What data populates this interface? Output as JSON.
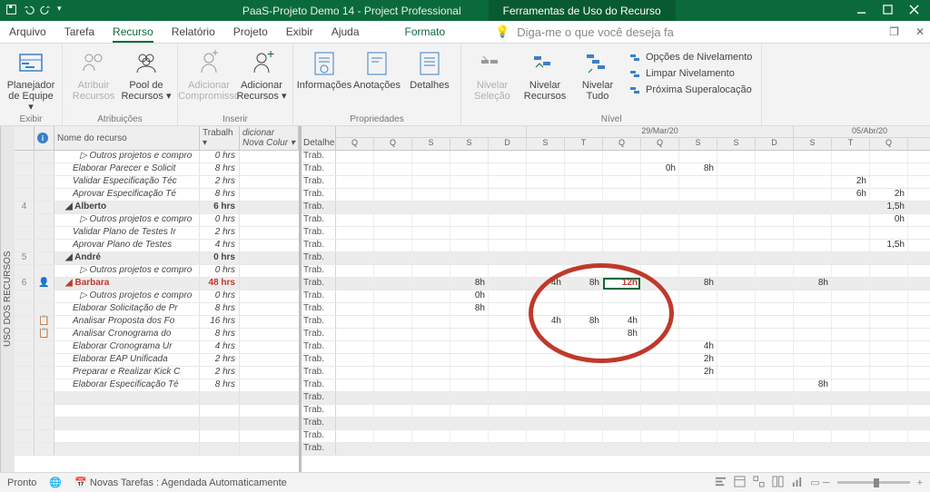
{
  "titlebar": {
    "project_title": "PaaS-Projeto Demo 14  -  Project Professional",
    "context_tab": "Ferramentas de Uso do Recurso"
  },
  "menubar": {
    "tabs": [
      "Arquivo",
      "Tarefa",
      "Recurso",
      "Relatório",
      "Projeto",
      "Exibir",
      "Ajuda",
      "Formato"
    ],
    "tellme_placeholder": "Diga-me o que você deseja fa"
  },
  "ribbon": {
    "groups": [
      {
        "label": "Exibir",
        "buttons": [
          {
            "l1": "Planejador",
            "l2": "de Equipe ▾"
          }
        ]
      },
      {
        "label": "Atribuições",
        "buttons": [
          {
            "l1": "Atribuir",
            "l2": "Recursos",
            "disabled": true
          },
          {
            "l1": "Pool de",
            "l2": "Recursos ▾"
          }
        ]
      },
      {
        "label": "Inserir",
        "buttons": [
          {
            "l1": "Adicionar",
            "l2": "Compromisso",
            "disabled": true
          },
          {
            "l1": "Adicionar",
            "l2": "Recursos ▾"
          }
        ]
      },
      {
        "label": "Propriedades",
        "buttons": [
          {
            "l1": "Informações",
            "l2": ""
          },
          {
            "l1": "Anotações",
            "l2": ""
          },
          {
            "l1": "Detalhes",
            "l2": ""
          }
        ]
      },
      {
        "label": "Nível",
        "buttons": [
          {
            "l1": "Nivelar",
            "l2": "Seleção",
            "disabled": true
          },
          {
            "l1": "Nivelar",
            "l2": "Recursos"
          },
          {
            "l1": "Nivelar",
            "l2": "Tudo"
          }
        ],
        "options": [
          "Opções de Nivelamento",
          "Limpar Nivelamento",
          "Próxima Superalocação"
        ]
      }
    ]
  },
  "sidebar_label": "USO DOS RECURSOS",
  "left_headers": {
    "name": "Nome do recurso",
    "work": "Trabalh ▾",
    "addcol": "dicionar Nova Colur ▾"
  },
  "right_headers": {
    "detail": "Detalhe",
    "weeks": [
      {
        "label": "",
        "span": 5
      },
      {
        "label": "29/Mar/20",
        "span": 7
      },
      {
        "label": "05/Abr/20",
        "span": 4
      }
    ],
    "days": [
      "Q",
      "Q",
      "S",
      "S",
      "D",
      "S",
      "T",
      "Q",
      "Q",
      "S",
      "S",
      "D",
      "S",
      "T",
      "Q"
    ]
  },
  "rows": [
    {
      "rn": "",
      "name": "▷ Outros projetos e compro",
      "work": "0 hrs",
      "det": "Trab.",
      "cells": {}
    },
    {
      "rn": "",
      "name": "Elaborar Parecer e Solicit",
      "work": "8 hrs",
      "det": "Trab.",
      "cells": {
        "8": "0h",
        "9": "8h"
      }
    },
    {
      "rn": "",
      "name": "Validar Especificação Téc",
      "work": "2 hrs",
      "det": "Trab.",
      "cells": {
        "13": "2h"
      }
    },
    {
      "rn": "",
      "name": "Aprovar Especificação Té",
      "work": "8 hrs",
      "det": "Trab.",
      "cells": {
        "13": "6h",
        "14": "2h"
      }
    },
    {
      "rn": "4",
      "name": "◢ Alberto",
      "work": "6 hrs",
      "det": "Trab.",
      "bold": true,
      "shade": true,
      "cells": {
        "14": "1,5h"
      }
    },
    {
      "rn": "",
      "name": "▷ Outros projetos e compro",
      "work": "0 hrs",
      "det": "Trab.",
      "cells": {
        "14": "0h"
      }
    },
    {
      "rn": "",
      "name": "Validar Plano de Testes Ir",
      "work": "2 hrs",
      "det": "Trab.",
      "cells": {}
    },
    {
      "rn": "",
      "name": "Aprovar Plano de Testes",
      "work": "4 hrs",
      "det": "Trab.",
      "cells": {
        "14": "1,5h"
      }
    },
    {
      "rn": "5",
      "name": "◢ André",
      "work": "0 hrs",
      "det": "Trab.",
      "bold": true,
      "shade": true,
      "cells": {}
    },
    {
      "rn": "",
      "name": "▷ Outros projetos e compro",
      "work": "0 hrs",
      "det": "Trab.",
      "cells": {}
    },
    {
      "rn": "6",
      "name": "◢ Barbara",
      "work": "48 hrs",
      "det": "Trab.",
      "red": true,
      "shade": true,
      "ind": "👤",
      "cells": {
        "3": "8h",
        "5": "4h",
        "6": "8h",
        "7": "12h",
        "9": "8h",
        "12": "8h"
      },
      "hl": 7,
      "redcells": [
        7
      ]
    },
    {
      "rn": "",
      "name": "▷ Outros projetos e compro",
      "work": "0 hrs",
      "det": "Trab.",
      "cells": {
        "3": "0h"
      }
    },
    {
      "rn": "",
      "name": "Elaborar Solicitação de Pr",
      "work": "8 hrs",
      "det": "Trab.",
      "cells": {
        "3": "8h"
      }
    },
    {
      "rn": "",
      "name": "Analisar Proposta dos Fo",
      "work": "16 hrs",
      "det": "Trab.",
      "ind": "📋",
      "cells": {
        "5": "4h",
        "6": "8h",
        "7": "4h"
      }
    },
    {
      "rn": "",
      "name": "Analisar Cronograma do",
      "work": "8 hrs",
      "det": "Trab.",
      "ind": "📋",
      "cells": {
        "7": "8h"
      }
    },
    {
      "rn": "",
      "name": "Elaborar Cronograma Ur",
      "work": "4 hrs",
      "det": "Trab.",
      "cells": {
        "9": "4h"
      }
    },
    {
      "rn": "",
      "name": "Elaborar EAP Unificada",
      "work": "2 hrs",
      "det": "Trab.",
      "cells": {
        "9": "2h"
      }
    },
    {
      "rn": "",
      "name": "Preparar e Realizar Kick C",
      "work": "2 hrs",
      "det": "Trab.",
      "cells": {
        "9": "2h"
      }
    },
    {
      "rn": "",
      "name": "Elaborar Especificação Té",
      "work": "8 hrs",
      "det": "Trab.",
      "cells": {
        "12": "8h"
      }
    },
    {
      "rn": "",
      "name": "",
      "work": "",
      "det": "Trab.",
      "shade": true,
      "cells": {}
    },
    {
      "rn": "",
      "name": "",
      "work": "",
      "det": "Trab.",
      "cells": {}
    },
    {
      "rn": "",
      "name": "",
      "work": "",
      "det": "Trab.",
      "shade": true,
      "cells": {}
    },
    {
      "rn": "",
      "name": "",
      "work": "",
      "det": "Trab.",
      "cells": {}
    },
    {
      "rn": "",
      "name": "",
      "work": "",
      "det": "Trab.",
      "shade": true,
      "cells": {}
    }
  ],
  "statusbar": {
    "ready": "Pronto",
    "newtasks": "Novas Tarefas : Agendada Automaticamente"
  }
}
